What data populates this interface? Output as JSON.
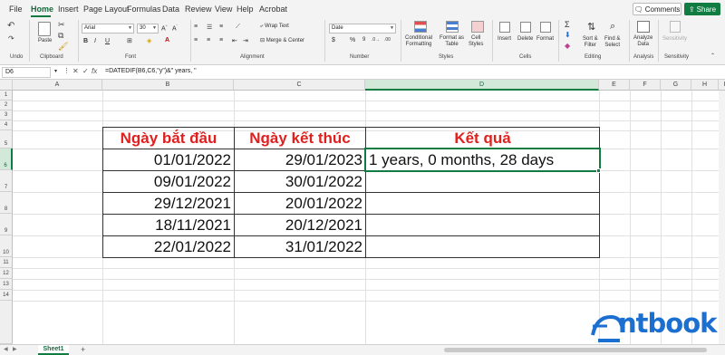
{
  "menu": {
    "tabs": [
      "File",
      "Home",
      "Insert",
      "Page Layout",
      "Formulas",
      "Data",
      "Review",
      "View",
      "Help",
      "Acrobat"
    ],
    "comments_label": "Comments",
    "share_label": "Share"
  },
  "ribbon": {
    "undo": "Undo",
    "clipboard": {
      "paste": "Paste",
      "label": "Clipboard"
    },
    "font": {
      "name": "Arial",
      "size": "30",
      "label": "Font"
    },
    "alignment": {
      "wrap_text": "Wrap Text",
      "merge_center": "Merge & Center",
      "label": "Alignment"
    },
    "number": {
      "format": "Date",
      "label": "Number"
    },
    "styles": {
      "conditional_formatting": "Conditional\nFormatting",
      "format_as_table": "Format as\nTable",
      "cell_styles": "Cell\nStyles",
      "label": "Styles"
    },
    "cells": {
      "insert": "Insert",
      "delete": "Delete",
      "format": "Format",
      "label": "Cells"
    },
    "editing": {
      "sort_filter": "Sort &\nFilter",
      "find_select": "Find &\nSelect",
      "label": "Editing"
    },
    "analysis": {
      "analyze_data": "Analyze\nData",
      "label": "Analysis"
    },
    "sensitivity": {
      "button": "Sensitivity",
      "label": "Sensitivity"
    }
  },
  "formula_bar": {
    "name_box": "D6",
    "fx": "fx",
    "formula": "=DATEDIF(B6,C6,\"y\")&\" years, \""
  },
  "columns": [
    "A",
    "B",
    "C",
    "D",
    "E",
    "F",
    "G",
    "H",
    "I"
  ],
  "rows": [
    "1",
    "2",
    "3",
    "4",
    "5",
    "6",
    "7",
    "8",
    "9",
    "10",
    "11",
    "12",
    "13",
    "14"
  ],
  "table": {
    "headers": [
      "Ngày bắt đầu",
      "Ngày kết thúc",
      "Kết quả"
    ],
    "rows": [
      {
        "start": "01/01/2022",
        "end": "29/01/2023",
        "result": "1 years, 0 months, 28 days"
      },
      {
        "start": "09/01/2022",
        "end": "30/01/2022",
        "result": ""
      },
      {
        "start": "29/12/2021",
        "end": "20/01/2022",
        "result": ""
      },
      {
        "start": "18/11/2021",
        "end": "20/12/2021",
        "result": ""
      },
      {
        "start": "22/01/2022",
        "end": "31/01/2022",
        "result": ""
      }
    ]
  },
  "sheet": {
    "tab": "Sheet1",
    "add": "+"
  },
  "watermark": {
    "text": "ntbook"
  }
}
